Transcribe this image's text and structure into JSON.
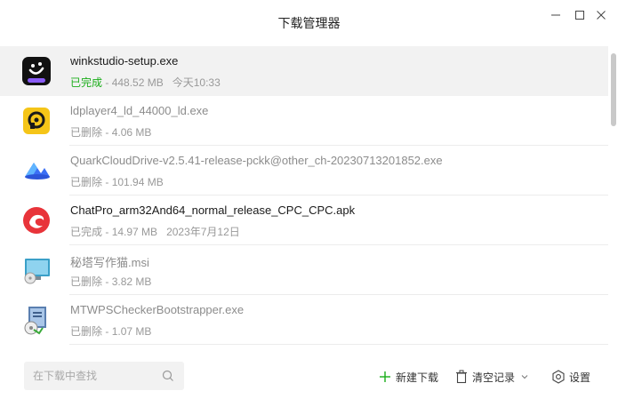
{
  "window": {
    "title": "下载管理器"
  },
  "downloads": [
    {
      "filename": "winkstudio-setup.exe",
      "status": "已完成",
      "size": "448.52 MB",
      "time": "今天10:33",
      "icon": "winkstudio-icon"
    },
    {
      "filename": "ldplayer4_ld_44000_ld.exe",
      "status": "已删除",
      "size": "4.06 MB",
      "time": "",
      "icon": "ldplayer-icon"
    },
    {
      "filename": "QuarkCloudDrive-v2.5.41-release-pckk@other_ch-20230713201852.exe",
      "status": "已删除",
      "size": "101.94 MB",
      "time": "",
      "icon": "quark-cloud-icon"
    },
    {
      "filename": "ChatPro_arm32And64_normal_release_CPC_CPC.apk",
      "status": "已完成",
      "size": "14.97 MB",
      "time": "2023年7月12日",
      "icon": "chatpro-icon"
    },
    {
      "filename": "秘塔写作猫.msi",
      "status": "已删除",
      "size": "3.82 MB",
      "time": "",
      "icon": "msi-installer-icon"
    },
    {
      "filename": "MTWPSCheckerBootstrapper.exe",
      "status": "已删除",
      "size": "1.07 MB",
      "time": "",
      "icon": "installer-exe-icon"
    }
  ],
  "separator": " - ",
  "footer": {
    "search_placeholder": "在下载中查找",
    "new_download": "新建下载",
    "clear_records": "清空记录",
    "settings": "设置"
  },
  "colors": {
    "completed": "#1aad19",
    "accent_green": "#1aad19",
    "muted": "#999999"
  }
}
